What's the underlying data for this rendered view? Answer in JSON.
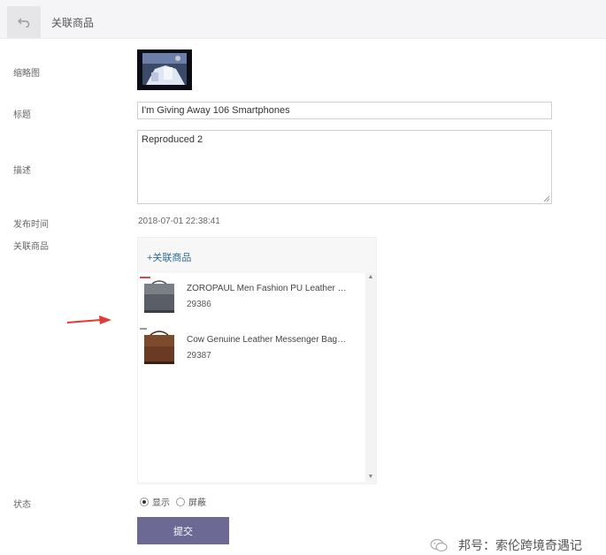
{
  "header": {
    "title": "关联商品"
  },
  "form": {
    "thumbnail_label": "缩略图",
    "title_label": "标题",
    "title_value": "I'm Giving Away 106 Smartphones",
    "description_label": "描述",
    "description_value": "Reproduced 2",
    "publish_time_label": "发布时间",
    "publish_time_value": "2018-07-01 22:38:41",
    "related_products_label": "关联商品",
    "status_label": "状态"
  },
  "products": {
    "add_link": "+关联商品",
    "items": [
      {
        "name": "ZOROPAUL Men Fashion PU Leather C...",
        "id": "29386"
      },
      {
        "name": "Cow Genuine Leather Messenger Bags ...",
        "id": "29387"
      }
    ]
  },
  "status": {
    "options": [
      {
        "label": "显示",
        "selected": true
      },
      {
        "label": "屏蔽",
        "selected": false
      }
    ]
  },
  "submit_label": "提交",
  "watermark": {
    "text": "邦号：索伦跨境奇遇记"
  },
  "colors": {
    "accent": "#6c6a94",
    "link": "#2f6d94",
    "arrow": "#e53935"
  }
}
